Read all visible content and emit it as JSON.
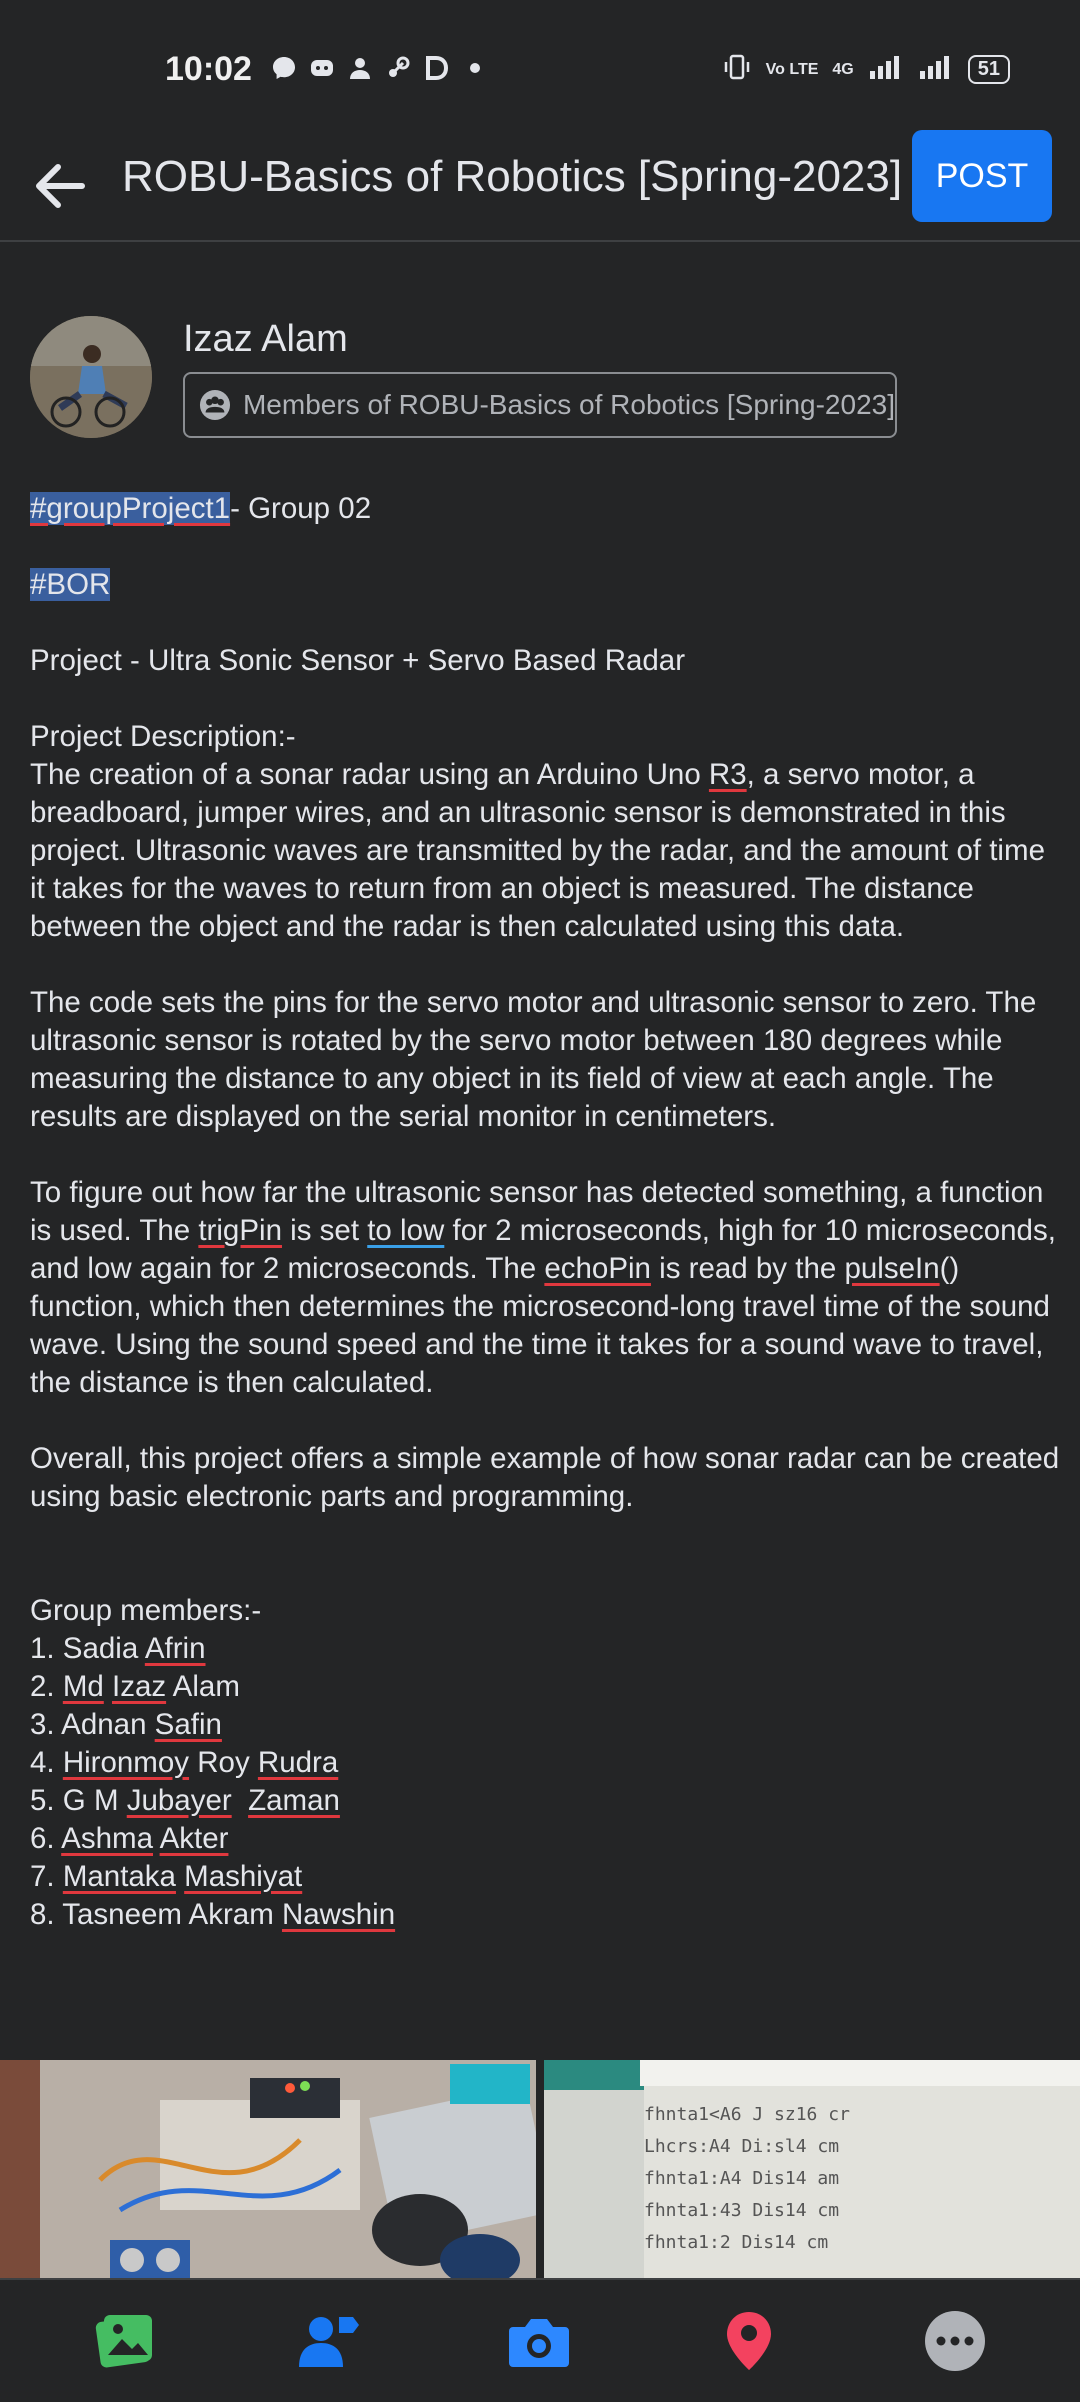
{
  "status_bar": {
    "time": "10:02",
    "battery": "51",
    "network": "4G",
    "volte": "Vo LTE"
  },
  "header": {
    "title": "ROBU-Basics of Robotics [Spring-2023]",
    "post_button": "POST"
  },
  "author": {
    "name": "Izaz Alam",
    "audience": "Members of ROBU-Basics of Robotics [Spring-2023]"
  },
  "post": {
    "hashtag1": "#groupProject1",
    "hashtag1_suffix": "- Group 02",
    "hashtag2": "#BOR",
    "project_title": "Project - Ultra Sonic Sensor + Servo Based Radar",
    "desc_heading": "Project Description:-",
    "p1_a": " The creation of a sonar radar using an Arduino Uno ",
    "p1_r3": "R3",
    "p1_b": ", a servo motor, a breadboard, jumper wires, and an ultrasonic sensor is demonstrated in this project. Ultrasonic waves are transmitted by the radar, and the amount of time it takes for the waves to return from an object is measured. The distance between the object and the radar is then calculated using this data.",
    "p2": "The code sets the pins for the servo motor and ultrasonic sensor to zero. The ultrasonic sensor is rotated by the servo motor between 180 degrees while measuring the distance to any object in its field of view at each angle. The results are displayed on the serial monitor in centimeters.",
    "p3_a": "To figure out how far the ultrasonic sensor has detected something, a function is used. The ",
    "p3_trig": "trigPin",
    "p3_b": " is set ",
    "p3_tolow": "to low",
    "p3_c": " for 2 microseconds, high for 10 microseconds, and low again for 2 microseconds. The ",
    "p3_echo": "echoPin",
    "p3_d": " is read by the ",
    "p3_pulse": "pulseIn",
    "p3_e": "() function, which then determines the microsecond-long travel time of the sound wave. Using the sound speed and the time it takes for a sound wave to travel, the distance is then calculated.",
    "p4": "Overall, this project offers a simple example of how sonar radar can be created using basic electronic parts and programming.",
    "members_heading": "Group members:-",
    "m1_a": "1. Sadia ",
    "m1_b": "Afrin",
    "m2_a": "2. ",
    "m2_b": "Md",
    "m2_c": " ",
    "m2_d": "Izaz",
    "m2_e": " Alam",
    "m3_a": "3. Adnan ",
    "m3_b": "Safin",
    "m4_a": "4. ",
    "m4_b": "Hironmoy",
    "m4_c": " Roy ",
    "m4_d": "Rudra",
    "m5_a": "5. G M ",
    "m5_b": "Jubayer",
    "m5_c": "  ",
    "m5_d": "Zaman",
    "m6_a": "6. ",
    "m6_b": "Ashma",
    "m6_c": " ",
    "m6_d": "Akter",
    "m7_a": "7. ",
    "m7_b": "Mantaka",
    "m7_c": " ",
    "m7_d": "Mashiyat",
    "m8_a": "8. Tasneem Akram ",
    "m8_b": "Nawshin"
  },
  "bottom_bar": {
    "icons": [
      "photo-icon",
      "tag-people-icon",
      "camera-icon",
      "location-pin-icon",
      "more-icon"
    ],
    "colors": {
      "photo": "#45bd62",
      "tag": "#1877f2",
      "camera": "#2d88ff",
      "location": "#f3425f",
      "more": "#b0b3b8"
    }
  },
  "accent": "#1877f2"
}
